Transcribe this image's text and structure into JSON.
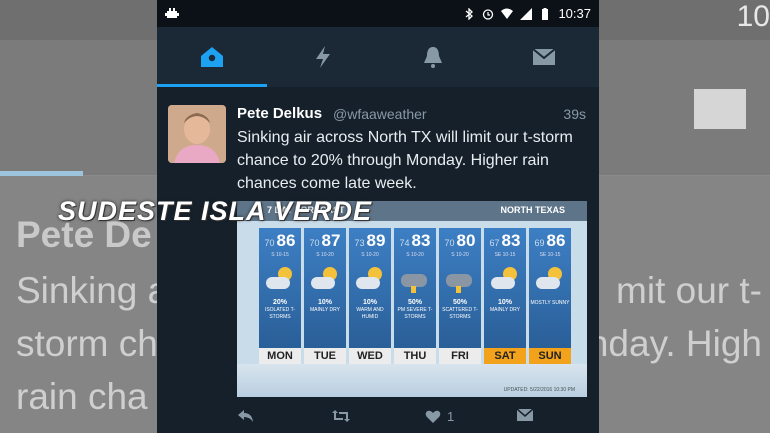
{
  "status_bar": {
    "time": "10:37"
  },
  "tabs": [
    {
      "name": "home",
      "active": true
    },
    {
      "name": "notifications-bolt",
      "active": false
    },
    {
      "name": "alerts-bell",
      "active": false
    },
    {
      "name": "messages",
      "active": false
    }
  ],
  "tweet": {
    "author_name": "Pete Delkus",
    "handle": "@wfaaweather",
    "time_ago": "39s",
    "text": "Sinking air across North TX will limit our t-storm chance to 20% through Monday. Higher rain chances come late week.",
    "likes": "1"
  },
  "overlay_title": "SUDESTE ISLA VERDE",
  "forecast": {
    "header_left": "7 DAY FORECAST",
    "header_right": "NORTH TEXAS",
    "days": [
      {
        "dow": "MON",
        "lo": "70",
        "hi": "86",
        "wind": "S 10-15",
        "pct": "20%",
        "desc": "ISOLATED T-STORMS",
        "icon": "sun-cloud",
        "weekend": false
      },
      {
        "dow": "TUE",
        "lo": "70",
        "hi": "87",
        "wind": "S 10-20",
        "pct": "10%",
        "desc": "MAINLY DRY",
        "icon": "sun-cloud",
        "weekend": false
      },
      {
        "dow": "WED",
        "lo": "73",
        "hi": "89",
        "wind": "S 10-20",
        "pct": "10%",
        "desc": "WARM AND HUMID",
        "icon": "sun-cloud",
        "weekend": false
      },
      {
        "dow": "THU",
        "lo": "74",
        "hi": "83",
        "wind": "S 10-20",
        "pct": "50%",
        "desc": "PM SEVERE T-STORMS",
        "icon": "storm",
        "weekend": false
      },
      {
        "dow": "FRI",
        "lo": "70",
        "hi": "80",
        "wind": "S 10-20",
        "pct": "50%",
        "desc": "SCATTERED T-STORMS",
        "icon": "storm",
        "weekend": false
      },
      {
        "dow": "SAT",
        "lo": "67",
        "hi": "83",
        "wind": "SE 10-15",
        "pct": "10%",
        "desc": "MAINLY DRY",
        "icon": "sun-cloud",
        "weekend": true
      },
      {
        "dow": "SUN",
        "lo": "69",
        "hi": "86",
        "wind": "SE 10-15",
        "pct": "",
        "desc": "MOSTLY SUNNY",
        "icon": "sun-cloud",
        "weekend": true
      }
    ],
    "updated": "UPDATED: 5/22/2016  10:30 PM"
  },
  "background_copy": {
    "name": "Pete De",
    "line1_left": "Sinking a",
    "line2_left": "storm ch",
    "line3_left": "rain cha",
    "line1_right": "mit our t-",
    "line2_right": "nday. High",
    "status_right": "10"
  },
  "colors": {
    "accent": "#1da1f2",
    "panel": "#15202b",
    "tabbar": "#1b2836",
    "weekend": "#f2a31b"
  }
}
